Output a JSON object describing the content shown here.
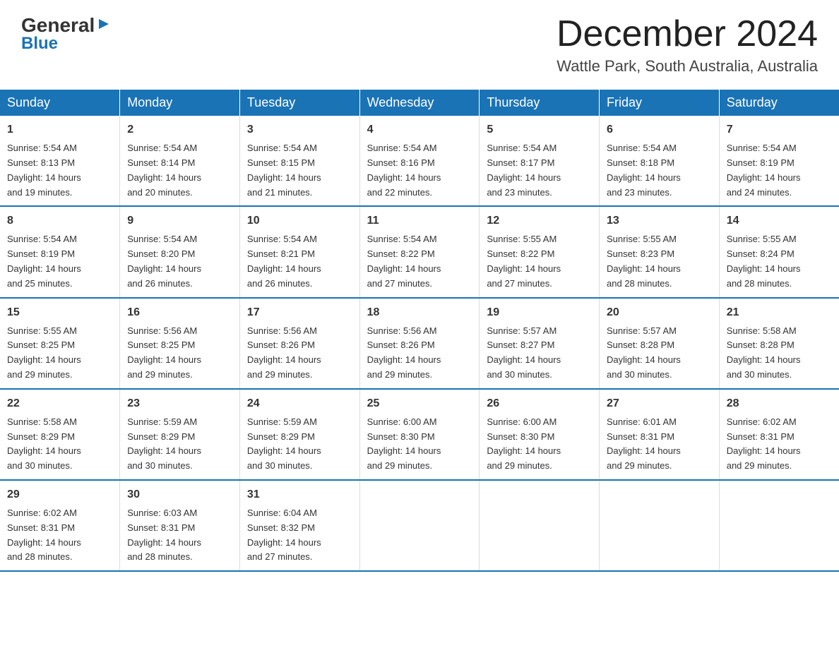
{
  "header": {
    "logo_line1": "General",
    "logo_arrow": "▶",
    "logo_line2": "Blue",
    "month_title": "December 2024",
    "location": "Wattle Park, South Australia, Australia"
  },
  "weekdays": [
    "Sunday",
    "Monday",
    "Tuesday",
    "Wednesday",
    "Thursday",
    "Friday",
    "Saturday"
  ],
  "weeks": [
    [
      {
        "day": "1",
        "sunrise": "5:54 AM",
        "sunset": "8:13 PM",
        "daylight": "14 hours and 19 minutes."
      },
      {
        "day": "2",
        "sunrise": "5:54 AM",
        "sunset": "8:14 PM",
        "daylight": "14 hours and 20 minutes."
      },
      {
        "day": "3",
        "sunrise": "5:54 AM",
        "sunset": "8:15 PM",
        "daylight": "14 hours and 21 minutes."
      },
      {
        "day": "4",
        "sunrise": "5:54 AM",
        "sunset": "8:16 PM",
        "daylight": "14 hours and 22 minutes."
      },
      {
        "day": "5",
        "sunrise": "5:54 AM",
        "sunset": "8:17 PM",
        "daylight": "14 hours and 23 minutes."
      },
      {
        "day": "6",
        "sunrise": "5:54 AM",
        "sunset": "8:18 PM",
        "daylight": "14 hours and 23 minutes."
      },
      {
        "day": "7",
        "sunrise": "5:54 AM",
        "sunset": "8:19 PM",
        "daylight": "14 hours and 24 minutes."
      }
    ],
    [
      {
        "day": "8",
        "sunrise": "5:54 AM",
        "sunset": "8:19 PM",
        "daylight": "14 hours and 25 minutes."
      },
      {
        "day": "9",
        "sunrise": "5:54 AM",
        "sunset": "8:20 PM",
        "daylight": "14 hours and 26 minutes."
      },
      {
        "day": "10",
        "sunrise": "5:54 AM",
        "sunset": "8:21 PM",
        "daylight": "14 hours and 26 minutes."
      },
      {
        "day": "11",
        "sunrise": "5:54 AM",
        "sunset": "8:22 PM",
        "daylight": "14 hours and 27 minutes."
      },
      {
        "day": "12",
        "sunrise": "5:55 AM",
        "sunset": "8:22 PM",
        "daylight": "14 hours and 27 minutes."
      },
      {
        "day": "13",
        "sunrise": "5:55 AM",
        "sunset": "8:23 PM",
        "daylight": "14 hours and 28 minutes."
      },
      {
        "day": "14",
        "sunrise": "5:55 AM",
        "sunset": "8:24 PM",
        "daylight": "14 hours and 28 minutes."
      }
    ],
    [
      {
        "day": "15",
        "sunrise": "5:55 AM",
        "sunset": "8:25 PM",
        "daylight": "14 hours and 29 minutes."
      },
      {
        "day": "16",
        "sunrise": "5:56 AM",
        "sunset": "8:25 PM",
        "daylight": "14 hours and 29 minutes."
      },
      {
        "day": "17",
        "sunrise": "5:56 AM",
        "sunset": "8:26 PM",
        "daylight": "14 hours and 29 minutes."
      },
      {
        "day": "18",
        "sunrise": "5:56 AM",
        "sunset": "8:26 PM",
        "daylight": "14 hours and 29 minutes."
      },
      {
        "day": "19",
        "sunrise": "5:57 AM",
        "sunset": "8:27 PM",
        "daylight": "14 hours and 30 minutes."
      },
      {
        "day": "20",
        "sunrise": "5:57 AM",
        "sunset": "8:28 PM",
        "daylight": "14 hours and 30 minutes."
      },
      {
        "day": "21",
        "sunrise": "5:58 AM",
        "sunset": "8:28 PM",
        "daylight": "14 hours and 30 minutes."
      }
    ],
    [
      {
        "day": "22",
        "sunrise": "5:58 AM",
        "sunset": "8:29 PM",
        "daylight": "14 hours and 30 minutes."
      },
      {
        "day": "23",
        "sunrise": "5:59 AM",
        "sunset": "8:29 PM",
        "daylight": "14 hours and 30 minutes."
      },
      {
        "day": "24",
        "sunrise": "5:59 AM",
        "sunset": "8:29 PM",
        "daylight": "14 hours and 30 minutes."
      },
      {
        "day": "25",
        "sunrise": "6:00 AM",
        "sunset": "8:30 PM",
        "daylight": "14 hours and 29 minutes."
      },
      {
        "day": "26",
        "sunrise": "6:00 AM",
        "sunset": "8:30 PM",
        "daylight": "14 hours and 29 minutes."
      },
      {
        "day": "27",
        "sunrise": "6:01 AM",
        "sunset": "8:31 PM",
        "daylight": "14 hours and 29 minutes."
      },
      {
        "day": "28",
        "sunrise": "6:02 AM",
        "sunset": "8:31 PM",
        "daylight": "14 hours and 29 minutes."
      }
    ],
    [
      {
        "day": "29",
        "sunrise": "6:02 AM",
        "sunset": "8:31 PM",
        "daylight": "14 hours and 28 minutes."
      },
      {
        "day": "30",
        "sunrise": "6:03 AM",
        "sunset": "8:31 PM",
        "daylight": "14 hours and 28 minutes."
      },
      {
        "day": "31",
        "sunrise": "6:04 AM",
        "sunset": "8:32 PM",
        "daylight": "14 hours and 27 minutes."
      },
      null,
      null,
      null,
      null
    ]
  ],
  "labels": {
    "sunrise": "Sunrise:",
    "sunset": "Sunset:",
    "daylight": "Daylight:"
  }
}
